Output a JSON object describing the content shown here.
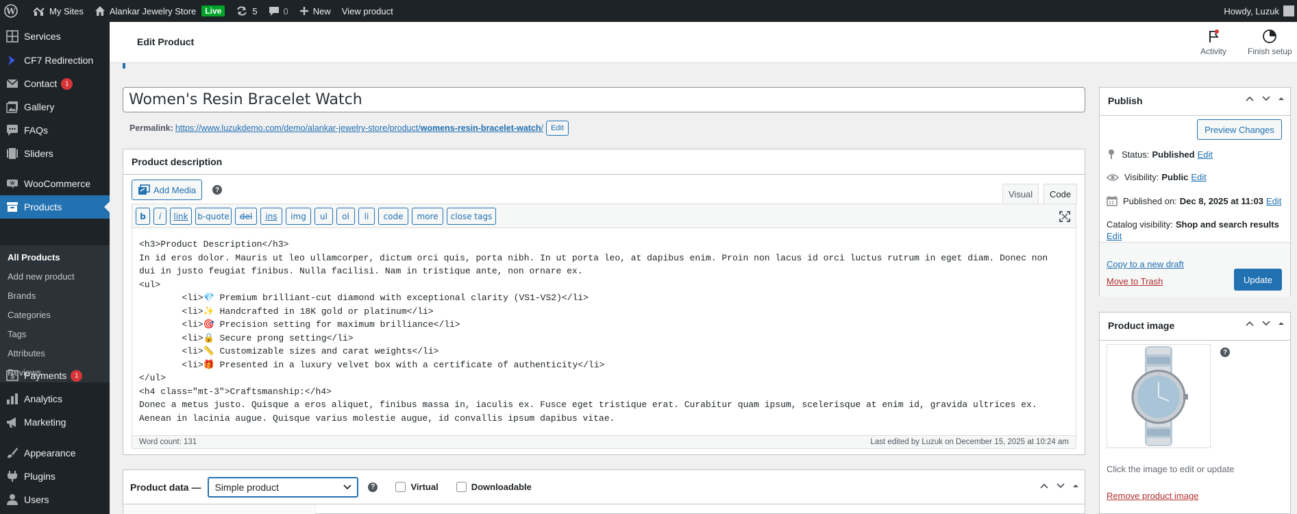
{
  "adminbar": {
    "my_sites": "My Sites",
    "site_name": "Alankar Jewelry Store",
    "live": "Live",
    "updates": "5",
    "comments": "0",
    "new": "New",
    "view_product": "View product",
    "howdy": "Howdy, Luzuk"
  },
  "sidebar": {
    "items": [
      {
        "label": "Services",
        "icon": "grid-icon"
      },
      {
        "label": "CF7 Redirection",
        "icon": "redirect-icon"
      },
      {
        "label": "Contact",
        "icon": "mail-icon",
        "badge": "1"
      },
      {
        "label": "Gallery",
        "icon": "gallery-icon"
      },
      {
        "label": "FAQs",
        "icon": "comment-icon"
      },
      {
        "label": "Sliders",
        "icon": "slides-icon"
      },
      {
        "label": "WooCommerce",
        "icon": "woo-icon"
      },
      {
        "label": "Products",
        "icon": "archive-icon"
      },
      {
        "label": "Payments",
        "icon": "dollar-icon",
        "badge": "1"
      },
      {
        "label": "Analytics",
        "icon": "chart-icon"
      },
      {
        "label": "Marketing",
        "icon": "megaphone-icon"
      },
      {
        "label": "Appearance",
        "icon": "brush-icon"
      },
      {
        "label": "Plugins",
        "icon": "plugin-icon"
      },
      {
        "label": "Users",
        "icon": "user-icon"
      }
    ],
    "submenu": [
      "All Products",
      "Add new product",
      "Brands",
      "Categories",
      "Tags",
      "Attributes",
      "Reviews"
    ]
  },
  "header": {
    "title": "Edit Product",
    "activity": "Activity",
    "finish_setup": "Finish setup"
  },
  "post": {
    "title": "Women's Resin Bracelet Watch",
    "permalink_label": "Permalink:",
    "permalink_base": "https://www.luzukdemo.com/demo/alankar-jewelry-store/product/",
    "permalink_slug": "womens-resin-bracelet-watch",
    "permalink_end": "/",
    "edit": "Edit"
  },
  "description": {
    "title": "Product description",
    "add_media": "Add Media",
    "tab_visual": "Visual",
    "tab_code": "Code",
    "quicktags": [
      "b",
      "i",
      "link",
      "b-quote",
      "del",
      "ins",
      "img",
      "ul",
      "ol",
      "li",
      "code",
      "more",
      "close tags"
    ],
    "content": "<h3>Product Description</h3>\nIn id eros dolor. Mauris ut leo ullamcorper, dictum orci quis, porta nibh. In ut porta leo, at dapibus enim. Proin non lacus id orci luctus rutrum in eget diam. Donec non\ndui in justo feugiat finibus. Nulla facilisi. Nam in tristique ante, non ornare ex.\n<ul>\n        <li>💎 Premium brilliant-cut diamond with exceptional clarity (VS1-VS2)</li>\n        <li>✨ Handcrafted in 18K gold or platinum</li>\n        <li>🎯 Precision setting for maximum brilliance</li>\n        <li>🔒 Secure prong setting</li>\n        <li>📏 Customizable sizes and carat weights</li>\n        <li>🎁 Presented in a luxury velvet box with a certificate of authenticity</li>\n</ul>\n<h4 class=\"mt-3\">Craftsmanship:</h4>\nDonec a metus justo. Quisque a eros aliquet, finibus massa in, iaculis ex. Fusce eget tristique erat. Curabitur quam ipsum, scelerisque at enim id, gravida ultrices ex.\nAenean in lacinia augue. Quisque varius molestie augue, id convallis ipsum dapibus vitae.",
    "word_count": "Word count: 131",
    "last_edited": "Last edited by Luzuk on December 15, 2025 at 10:24 am"
  },
  "product_data": {
    "title": "Product data —",
    "type": "Simple product",
    "virtual": "Virtual",
    "downloadable": "Downloadable"
  },
  "publish": {
    "title": "Publish",
    "preview": "Preview Changes",
    "status_label": "Status:",
    "status_value": "Published",
    "visibility_label": "Visibility:",
    "visibility_value": "Public",
    "published_label": "Published on:",
    "published_value": "Dec 8, 2025 at 11:03",
    "catalog_label": "Catalog visibility:",
    "catalog_value": "Shop and search results",
    "edit": "Edit",
    "copy_draft": "Copy to a new draft",
    "trash": "Move to Trash",
    "update": "Update"
  },
  "product_image": {
    "title": "Product image",
    "caption": "Click the image to edit or update",
    "remove": "Remove product image"
  },
  "colors": {
    "admin_dark": "#1d2327",
    "accent": "#2271b1",
    "badge": "#d63638",
    "live": "#00a32a"
  }
}
